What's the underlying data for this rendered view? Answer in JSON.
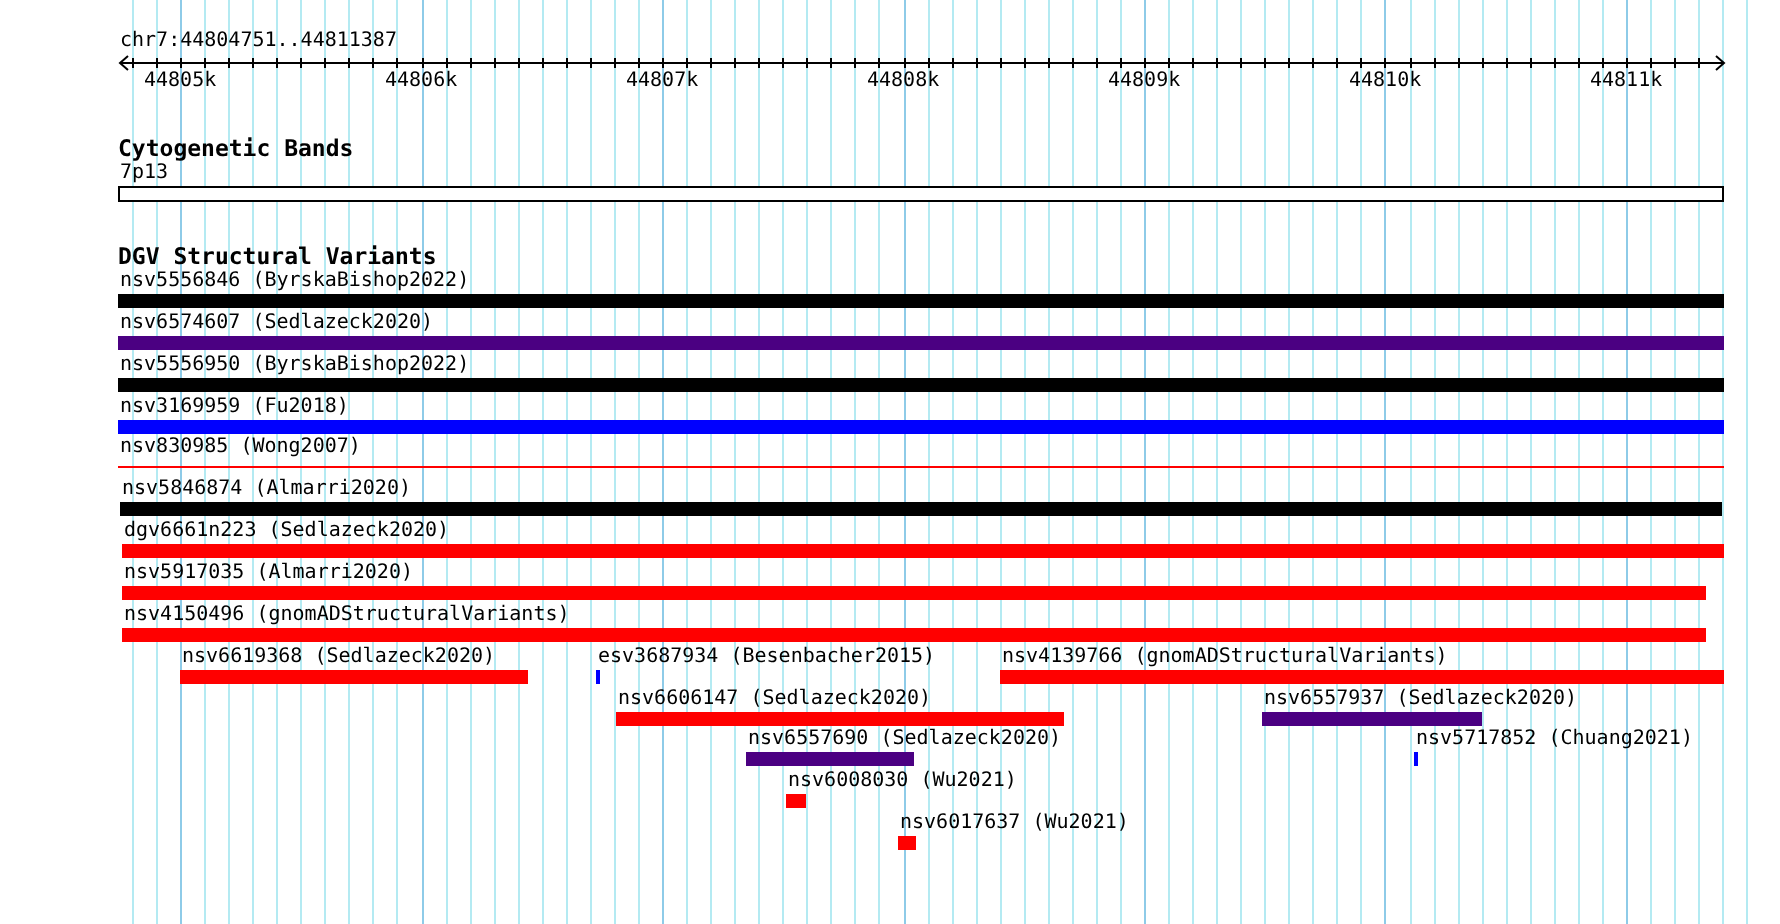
{
  "ruler": {
    "location": "chr7:44804751..44811387",
    "ticks": [
      "44805k",
      "44806k",
      "44807k",
      "44808k",
      "44809k",
      "44810k",
      "44811k"
    ]
  },
  "cytobands": {
    "title": "Cytogenetic Bands",
    "band": "7p13"
  },
  "variants": {
    "title": "DGV Structural Variants",
    "rows": [
      [
        {
          "label": "nsv5556846 (ByrskaBishop2022)",
          "color": "#000000",
          "kind": "bar"
        }
      ],
      [
        {
          "label": "nsv6574607 (Sedlazeck2020)",
          "color": "#4b0082",
          "kind": "bar"
        }
      ],
      [
        {
          "label": "nsv5556950 (ByrskaBishop2022)",
          "color": "#000000",
          "kind": "bar"
        }
      ],
      [
        {
          "label": "nsv3169959 (Fu2018)",
          "color": "#0000ff",
          "kind": "bar"
        }
      ],
      [
        {
          "label": "nsv830985 (Wong2007)",
          "color": "#ff0000",
          "kind": "line"
        }
      ],
      [
        {
          "label": "nsv5846874 (Almarri2020)",
          "color": "#000000",
          "kind": "bar"
        }
      ],
      [
        {
          "label": "dgv6661n223 (Sedlazeck2020)",
          "color": "#ff0000",
          "kind": "bar"
        }
      ],
      [
        {
          "label": "nsv5917035 (Almarri2020)",
          "color": "#ff0000",
          "kind": "bar"
        }
      ],
      [
        {
          "label": "nsv4150496 (gnomADStructuralVariants)",
          "color": "#ff0000",
          "kind": "bar"
        }
      ],
      [
        {
          "label": "nsv6619368 (Sedlazeck2020)",
          "color": "#ff0000",
          "kind": "bar"
        },
        {
          "label": "esv3687934 (Besenbacher2015)",
          "color": "#0000ff",
          "kind": "bar"
        },
        {
          "label": "nsv4139766 (gnomADStructuralVariants)",
          "color": "#ff0000",
          "kind": "bar"
        }
      ],
      [
        {
          "label": "nsv6606147 (Sedlazeck2020)",
          "color": "#ff0000",
          "kind": "bar"
        },
        {
          "label": "nsv6557937 (Sedlazeck2020)",
          "color": "#4b0082",
          "kind": "bar"
        }
      ],
      [
        {
          "label": "nsv6557690 (Sedlazeck2020)",
          "color": "#4b0082",
          "kind": "bar"
        },
        {
          "label": "nsv5717852 (Chuang2021)",
          "color": "#0000ff",
          "kind": "bar"
        }
      ],
      [
        {
          "label": "nsv6008030 (Wu2021)",
          "color": "#ff0000",
          "kind": "bar"
        }
      ],
      [
        {
          "label": "nsv6017637 (Wu2021)",
          "color": "#ff0000",
          "kind": "bar"
        }
      ]
    ]
  }
}
